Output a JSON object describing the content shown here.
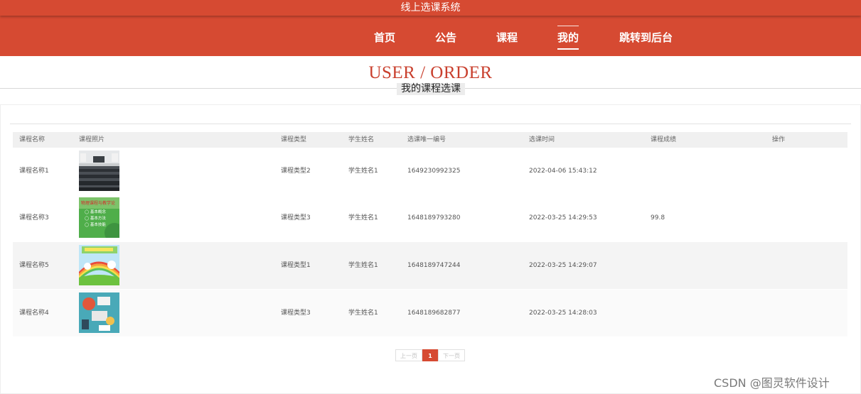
{
  "header": {
    "site_title": "线上选课系统",
    "nav": [
      "首页",
      "公告",
      "课程",
      "我的",
      "跳转到后台"
    ],
    "active_nav": "我的"
  },
  "page": {
    "title_en": "USER / ORDER",
    "title_cn": "我的课程选课"
  },
  "table": {
    "columns": [
      "课程名称",
      "课程照片",
      "课程类型",
      "学生姓名",
      "选课唯一编号",
      "选课时间",
      "课程成绩",
      "操作"
    ],
    "rows": [
      {
        "name": "课程名称1",
        "photo": "classroom-photo",
        "type": "课程类型2",
        "student": "学生姓名1",
        "id": "1649230992325",
        "time": "2022-04-06 15:43:12",
        "score": ""
      },
      {
        "name": "课程名称3",
        "photo": "green-course-cover",
        "type": "课程类型3",
        "student": "学生姓名1",
        "id": "1648189793280",
        "time": "2022-03-25 14:29:53",
        "score": "99.8"
      },
      {
        "name": "课程名称5",
        "photo": "rainbow-landscape",
        "type": "课程类型1",
        "student": "学生姓名1",
        "id": "1648189747244",
        "time": "2022-03-25 14:29:07",
        "score": ""
      },
      {
        "name": "课程名称4",
        "photo": "desk-illustration",
        "type": "课程类型3",
        "student": "学生姓名1",
        "id": "1648189682877",
        "time": "2022-03-25 14:28:03",
        "score": ""
      }
    ],
    "row_backgrounds": [
      "#ffffff",
      "#ffffff",
      "#f4f4f4",
      "#fafafa"
    ]
  },
  "pagination": {
    "prev": "上一页",
    "current": "1",
    "next": "下一页"
  },
  "watermark": "CSDN @图灵软件设计",
  "colors": {
    "brand": "#d64a32",
    "title": "#c9402e"
  },
  "thumb_text": {
    "green_cover": [
      "物理课程与教学论",
      "◯ 基本概念",
      "◯ 基本方法",
      "◯ 基本技能"
    ]
  }
}
